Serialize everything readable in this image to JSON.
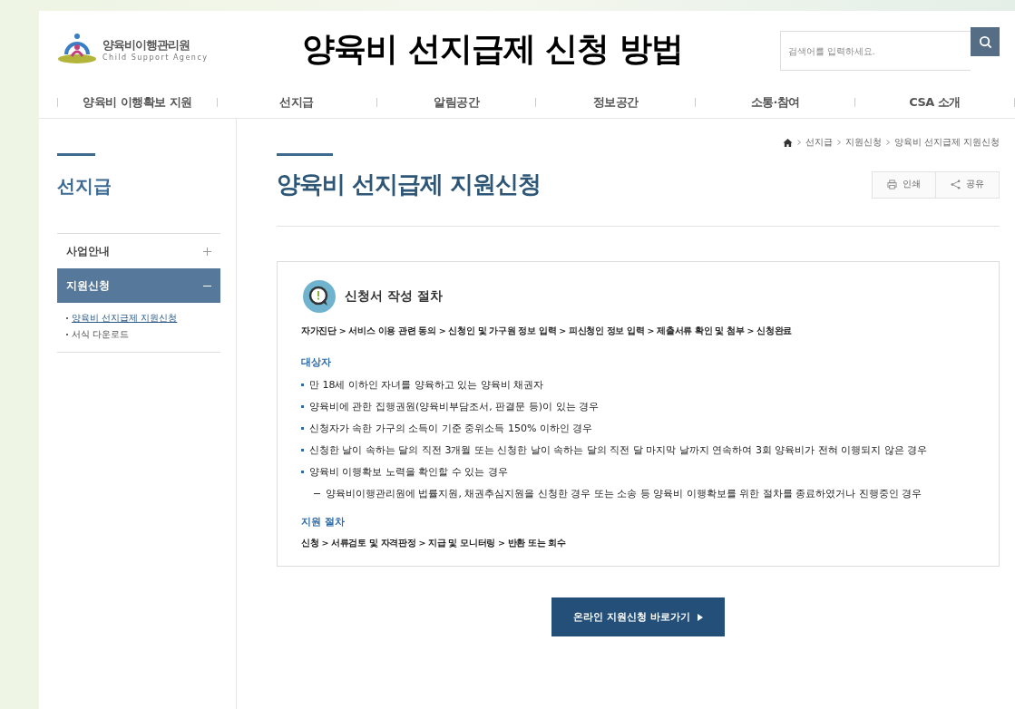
{
  "overlay_title": "양육비 선지급제 신청 방법",
  "logo": {
    "name": "양육비이행관리원",
    "subtitle": "Child Support Agency"
  },
  "search": {
    "placeholder": "검색어를 입력하세요."
  },
  "nav": [
    {
      "label": "양육비 이행확보 지원"
    },
    {
      "label": "선지급"
    },
    {
      "label": "알림공간"
    },
    {
      "label": "정보공간"
    },
    {
      "label": "소통·참여"
    },
    {
      "label": "CSA 소개"
    }
  ],
  "sidebar": {
    "title": "선지급",
    "items": [
      {
        "label": "사업안내",
        "expanded": false,
        "selected": false
      },
      {
        "label": "지원신청",
        "expanded": true,
        "selected": true,
        "children": [
          {
            "label": "양육비 선지급제 지원신청",
            "selected": true
          },
          {
            "label": "서식 다운로드",
            "selected": false
          }
        ]
      }
    ]
  },
  "breadcrumb": [
    "선지급",
    "지원신청",
    "양육비 선지급제 지원신청"
  ],
  "page_title": "양육비 선지급제 지원신청",
  "actions": [
    {
      "kind": "print",
      "label": "인쇄"
    },
    {
      "kind": "share",
      "label": "공유"
    }
  ],
  "panel": {
    "heading": "신청서 작성 절차",
    "steps": "자가진단 > 서비스 이용 관련 동의 > 신청인 및 가구원 정보 입력 > 피신청인 정보 입력 > 제출서류 확인 및 첨부 > 신청완료",
    "sections": [
      {
        "title": "대상자",
        "items": [
          {
            "kind": "bullet",
            "text": "만 18세 이하인 자녀를 양육하고 있는 양육비 채권자"
          },
          {
            "kind": "bullet",
            "text": "양육비에 관한 집행권원(양육비부담조서, 판결문 등)이 있는 경우"
          },
          {
            "kind": "bullet",
            "text": "신청자가 속한 가구의 소득이 기준 중위소득 150% 이하인 경우"
          },
          {
            "kind": "bullet",
            "text": "신청한 날이 속하는 달의 직전 3개월 또는 신청한 날이 속하는 달의 직전 달 마지막 날까지 연속하여 3회 양육비가 전혀 이행되지 않은 경우"
          },
          {
            "kind": "bullet",
            "text": "양육비 이행확보 노력을 확인할 수 있는 경우"
          },
          {
            "kind": "dash",
            "text": "양육비이행관리원에 법률지원, 채권추심지원을 신청한 경우 또는 소송 등 양육비 이행확보를 위한 절차를 종료하였거나 진행중인 경우"
          }
        ]
      },
      {
        "title": "지원 절차",
        "items": [
          {
            "kind": "plain",
            "text": "신청 > 서류검토 및 자격판정 > 지급 및 모니터링 > 반환 또는 회수"
          }
        ]
      }
    ]
  },
  "cta": {
    "label": "온라인 지원신청 바로가기"
  }
}
